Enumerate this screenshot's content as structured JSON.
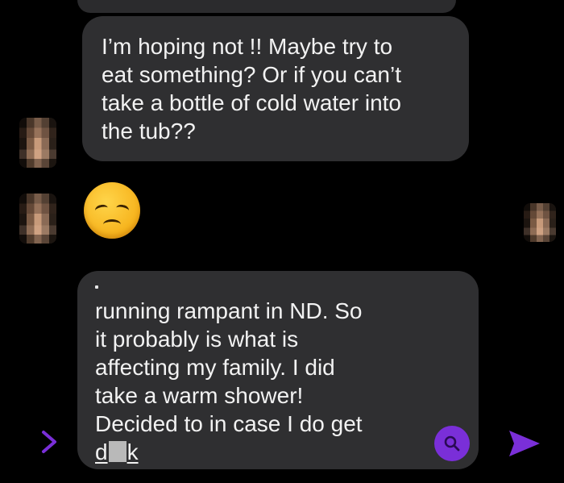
{
  "conversation": {
    "message_1": {
      "lines": [
        "I’m hoping not !! Maybe try to",
        "eat something? Or if you can’t",
        "take a bottle of cold water into",
        "the tub??"
      ]
    },
    "reaction_emoji": {
      "name": "pensive-face",
      "glyph": "😔"
    },
    "message_2": {
      "lines": [
        "running rampant in ND. So",
        "it probably is what is",
        "affecting my family. I did",
        "take a warm shower!",
        "Decided to in case I do get"
      ],
      "last_word_start": "d",
      "last_word_end": "k"
    }
  },
  "composer": {
    "expand_icon": "chevron-right-icon",
    "search_icon": "search-icon",
    "send_icon": "send-icon"
  },
  "colors": {
    "background": "#000000",
    "bubble": "#2f2f31",
    "text": "#f2f2f2",
    "accent": "#7a2fd8"
  }
}
